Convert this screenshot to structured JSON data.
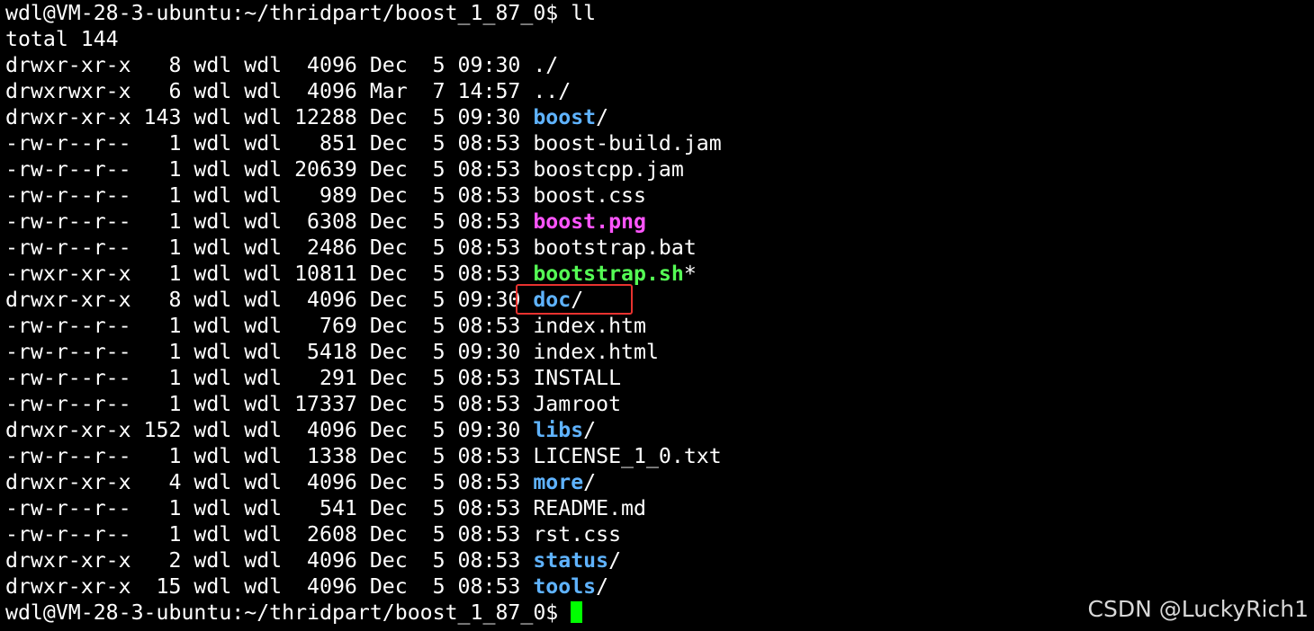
{
  "terminal": {
    "prompt": "wdl@VM-28-3-ubuntu:~/thridpart/boost_1_87_0$ ",
    "command": "ll",
    "total_line": "total 144",
    "entries": [
      {
        "meta": "drwxr-xr-x   8 wdl wdl  4096 Dec  5 09:30 ",
        "name": "./",
        "suffix": "",
        "kind": "plain"
      },
      {
        "meta": "drwxrwxr-x   6 wdl wdl  4096 Mar  7 14:57 ",
        "name": "../",
        "suffix": "",
        "kind": "plain"
      },
      {
        "meta": "drwxr-xr-x 143 wdl wdl 12288 Dec  5 09:30 ",
        "name": "boost",
        "suffix": "/",
        "kind": "dir"
      },
      {
        "meta": "-rw-r--r--   1 wdl wdl   851 Dec  5 08:53 ",
        "name": "boost-build.jam",
        "suffix": "",
        "kind": "plain"
      },
      {
        "meta": "-rw-r--r--   1 wdl wdl 20639 Dec  5 08:53 ",
        "name": "boostcpp.jam",
        "suffix": "",
        "kind": "plain"
      },
      {
        "meta": "-rw-r--r--   1 wdl wdl   989 Dec  5 08:53 ",
        "name": "boost.css",
        "suffix": "",
        "kind": "plain"
      },
      {
        "meta": "-rw-r--r--   1 wdl wdl  6308 Dec  5 08:53 ",
        "name": "boost.png",
        "suffix": "",
        "kind": "img"
      },
      {
        "meta": "-rw-r--r--   1 wdl wdl  2486 Dec  5 08:53 ",
        "name": "bootstrap.bat",
        "suffix": "",
        "kind": "plain"
      },
      {
        "meta": "-rwxr-xr-x   1 wdl wdl 10811 Dec  5 08:53 ",
        "name": "bootstrap.sh",
        "suffix": "*",
        "kind": "exec"
      },
      {
        "meta": "drwxr-xr-x   8 wdl wdl  4096 Dec  5 09:30 ",
        "name": "doc",
        "suffix": "/",
        "kind": "dir"
      },
      {
        "meta": "-rw-r--r--   1 wdl wdl   769 Dec  5 08:53 ",
        "name": "index.htm",
        "suffix": "",
        "kind": "plain"
      },
      {
        "meta": "-rw-r--r--   1 wdl wdl  5418 Dec  5 09:30 ",
        "name": "index.html",
        "suffix": "",
        "kind": "plain"
      },
      {
        "meta": "-rw-r--r--   1 wdl wdl   291 Dec  5 08:53 ",
        "name": "INSTALL",
        "suffix": "",
        "kind": "plain"
      },
      {
        "meta": "-rw-r--r--   1 wdl wdl 17337 Dec  5 08:53 ",
        "name": "Jamroot",
        "suffix": "",
        "kind": "plain"
      },
      {
        "meta": "drwxr-xr-x 152 wdl wdl  4096 Dec  5 09:30 ",
        "name": "libs",
        "suffix": "/",
        "kind": "dir"
      },
      {
        "meta": "-rw-r--r--   1 wdl wdl  1338 Dec  5 08:53 ",
        "name": "LICENSE_1_0.txt",
        "suffix": "",
        "kind": "plain"
      },
      {
        "meta": "drwxr-xr-x   4 wdl wdl  4096 Dec  5 08:53 ",
        "name": "more",
        "suffix": "/",
        "kind": "dir"
      },
      {
        "meta": "-rw-r--r--   1 wdl wdl   541 Dec  5 08:53 ",
        "name": "README.md",
        "suffix": "",
        "kind": "plain"
      },
      {
        "meta": "-rw-r--r--   1 wdl wdl  2608 Dec  5 08:53 ",
        "name": "rst.css",
        "suffix": "",
        "kind": "plain"
      },
      {
        "meta": "drwxr-xr-x   2 wdl wdl  4096 Dec  5 08:53 ",
        "name": "status",
        "suffix": "/",
        "kind": "dir"
      },
      {
        "meta": "drwxr-xr-x  15 wdl wdl  4096 Dec  5 08:53 ",
        "name": "tools",
        "suffix": "/",
        "kind": "dir"
      }
    ],
    "final_prompt": "wdl@VM-28-3-ubuntu:~/thridpart/boost_1_87_0$ "
  },
  "colors": {
    "background": "#000000",
    "text": "#ffffff",
    "directory": "#5fb3ff",
    "image": "#ff55ff",
    "executable": "#55ff55",
    "cursor": "#00ff00",
    "highlight_box": "#e8322f"
  },
  "highlight": {
    "target": "doc"
  },
  "watermark": {
    "text": "CSDN @LuckyRich1"
  }
}
